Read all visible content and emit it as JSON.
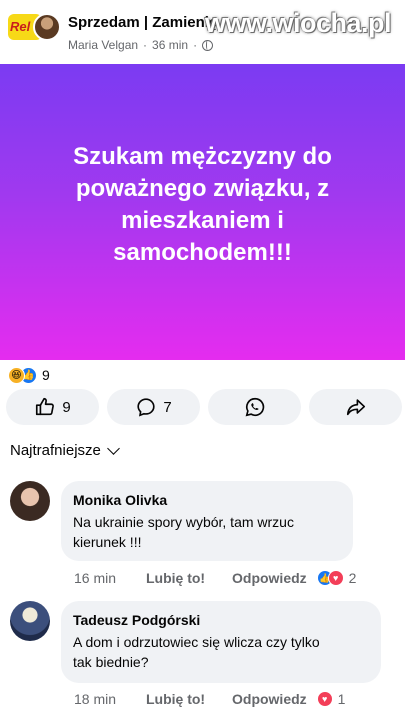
{
  "header": {
    "group_name": "Sprzedam | Zamienię",
    "author": "Maria Velgan",
    "separator": "·",
    "time": "36 min",
    "logo_text": "Rel",
    "watermark": "www.wiocha.pl"
  },
  "post": {
    "text": "Szukam mężczyzny do poważnego związku, z mieszkaniem i samochodem!!!",
    "gradient_colors": [
      "#7b3bf2",
      "#a139ef",
      "#e52cef"
    ]
  },
  "reactions": {
    "icons": [
      "haha-icon",
      "like-icon"
    ],
    "count": "9"
  },
  "actions": {
    "like_count": "9",
    "comment_count": "7"
  },
  "sort": {
    "label": "Najtrafniejsze"
  },
  "comments": [
    {
      "author": "Monika Olivka",
      "text": "Na ukrainie spory wybór,  tam wrzuc\nkierunek !!!",
      "time": "16 min",
      "like_label": "Lubię to!",
      "reply_label": "Odpowiedz",
      "reaction_count": "2"
    },
    {
      "author": "Tadeusz Podgórski",
      "text": "A dom i odrzutowiec się wlicza czy tylko\ntak biednie?",
      "time": "18 min",
      "like_label": "Lubię to!",
      "reply_label": "Odpowiedz",
      "reaction_count": "1"
    }
  ],
  "colors": {
    "accent": "#1877f2",
    "love": "#f33e58",
    "secondary_text": "#65676b",
    "bubble": "#f0f2f5"
  }
}
